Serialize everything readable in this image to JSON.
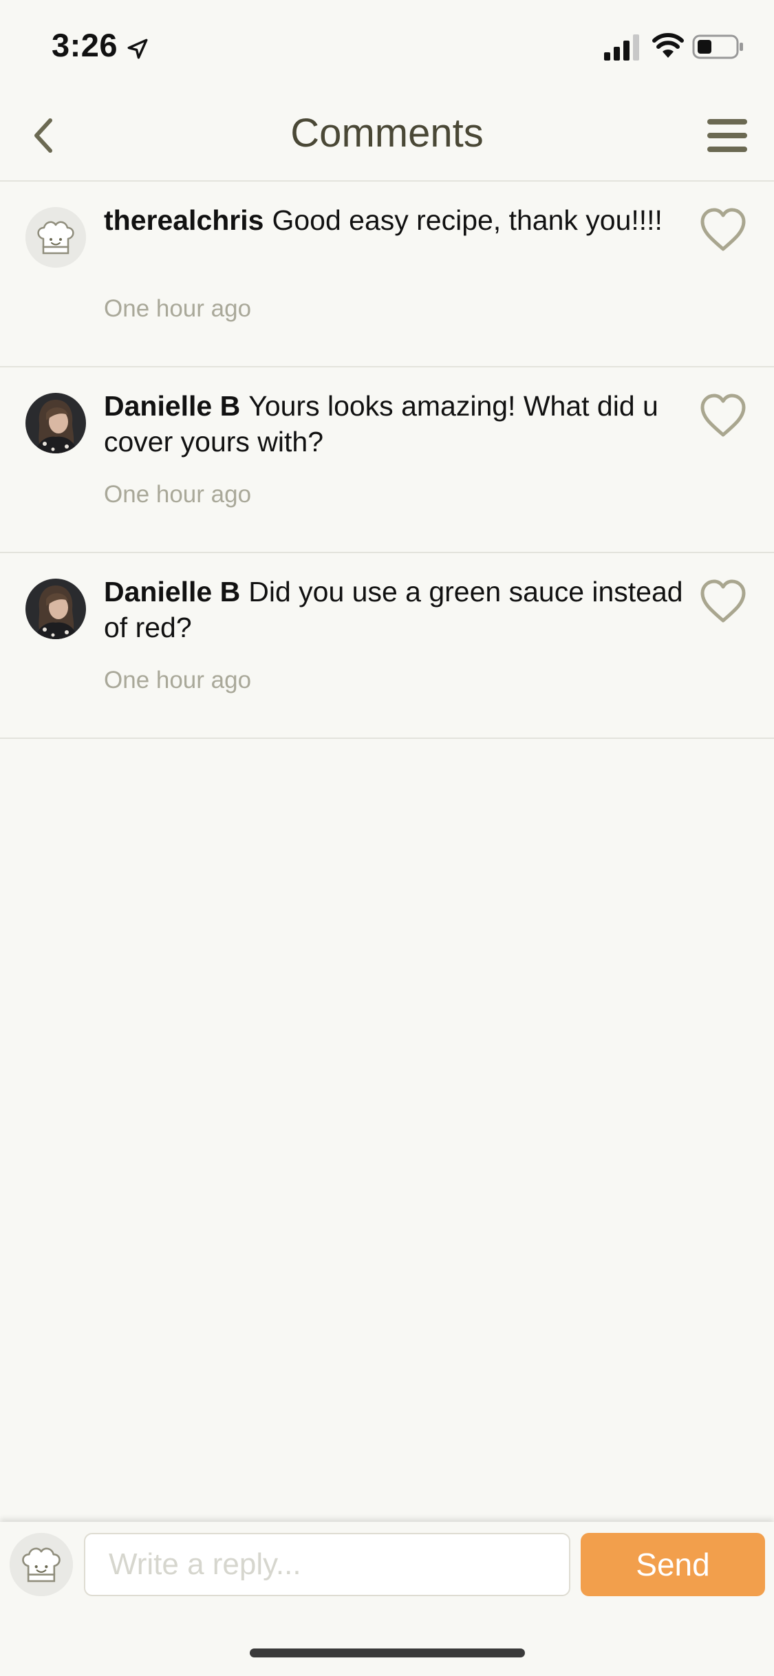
{
  "status_bar": {
    "time": "3:26"
  },
  "header": {
    "title": "Comments"
  },
  "comments": [
    {
      "author": "therealchris",
      "text": "Good easy recipe, thank you!!!!",
      "time": "One hour ago",
      "avatar": "chef-hat-avatar"
    },
    {
      "author": "Danielle B",
      "text": "Yours looks amazing! What did u cover yours with?",
      "time": "One hour ago",
      "avatar": "user-photo-avatar"
    },
    {
      "author": "Danielle B",
      "text": "Did you use a green sauce instead of red?",
      "time": "One hour ago",
      "avatar": "user-photo-avatar"
    }
  ],
  "reply": {
    "placeholder": "Write a reply...",
    "send_label": "Send"
  },
  "colors": {
    "background": "#f8f8f4",
    "accent": "#f29f4c",
    "icon": "#a9a68f",
    "title": "#4a4836"
  }
}
